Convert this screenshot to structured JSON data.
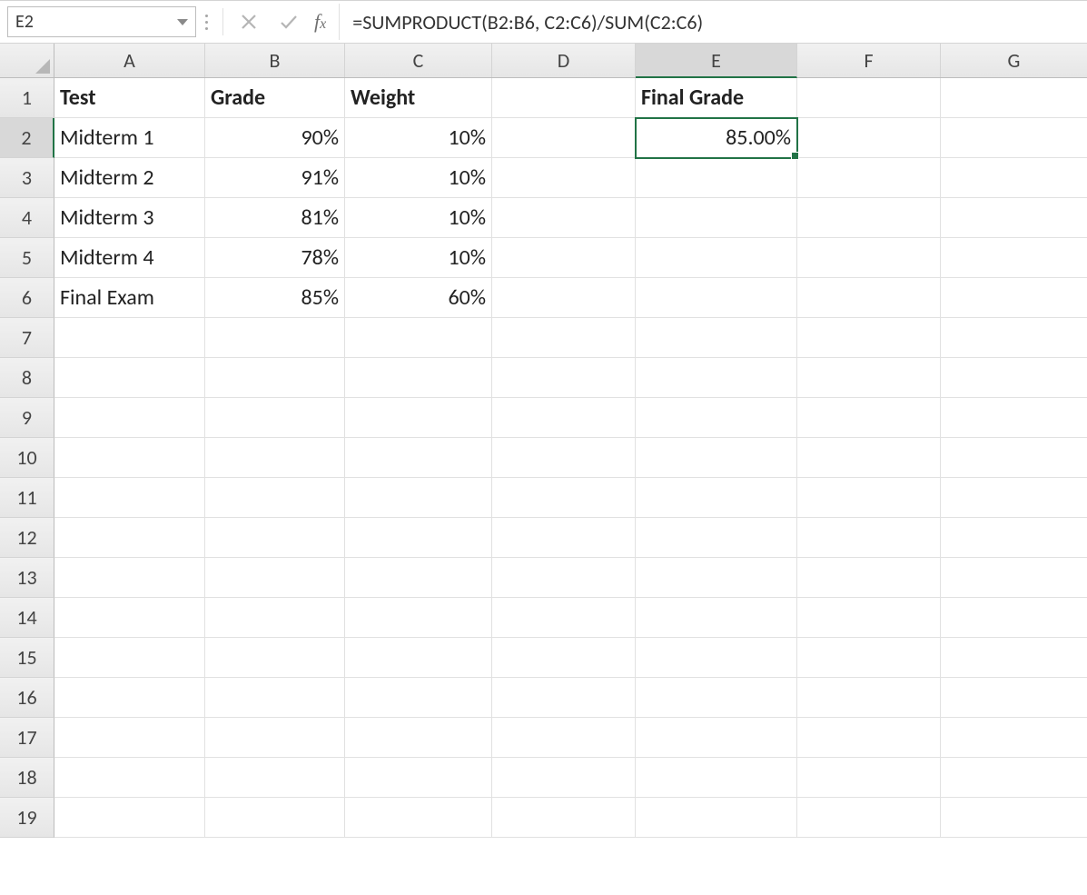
{
  "nameBox": "E2",
  "formula": "=SUMPRODUCT(B2:B6, C2:C6)/SUM(C2:C6)",
  "columns": [
    "A",
    "B",
    "C",
    "D",
    "E",
    "F",
    "G"
  ],
  "rowCount": 19,
  "activeCell": {
    "row": 2,
    "col": "E"
  },
  "cells": {
    "A1": {
      "v": "Test",
      "bold": true,
      "align": "left"
    },
    "B1": {
      "v": "Grade",
      "bold": true,
      "align": "left"
    },
    "C1": {
      "v": "Weight",
      "bold": true,
      "align": "left"
    },
    "E1": {
      "v": "Final Grade",
      "bold": true,
      "align": "left"
    },
    "A2": {
      "v": "Midterm 1",
      "align": "left"
    },
    "B2": {
      "v": "90%",
      "align": "right"
    },
    "C2": {
      "v": "10%",
      "align": "right"
    },
    "E2": {
      "v": "85.00%",
      "align": "right"
    },
    "A3": {
      "v": "Midterm 2",
      "align": "left"
    },
    "B3": {
      "v": "91%",
      "align": "right"
    },
    "C3": {
      "v": "10%",
      "align": "right"
    },
    "A4": {
      "v": "Midterm 3",
      "align": "left"
    },
    "B4": {
      "v": "81%",
      "align": "right"
    },
    "C4": {
      "v": "10%",
      "align": "right"
    },
    "A5": {
      "v": "Midterm 4",
      "align": "left"
    },
    "B5": {
      "v": "78%",
      "align": "right"
    },
    "C5": {
      "v": "10%",
      "align": "right"
    },
    "A6": {
      "v": "Final Exam",
      "align": "left"
    },
    "B6": {
      "v": "85%",
      "align": "right"
    },
    "C6": {
      "v": "60%",
      "align": "right"
    }
  }
}
